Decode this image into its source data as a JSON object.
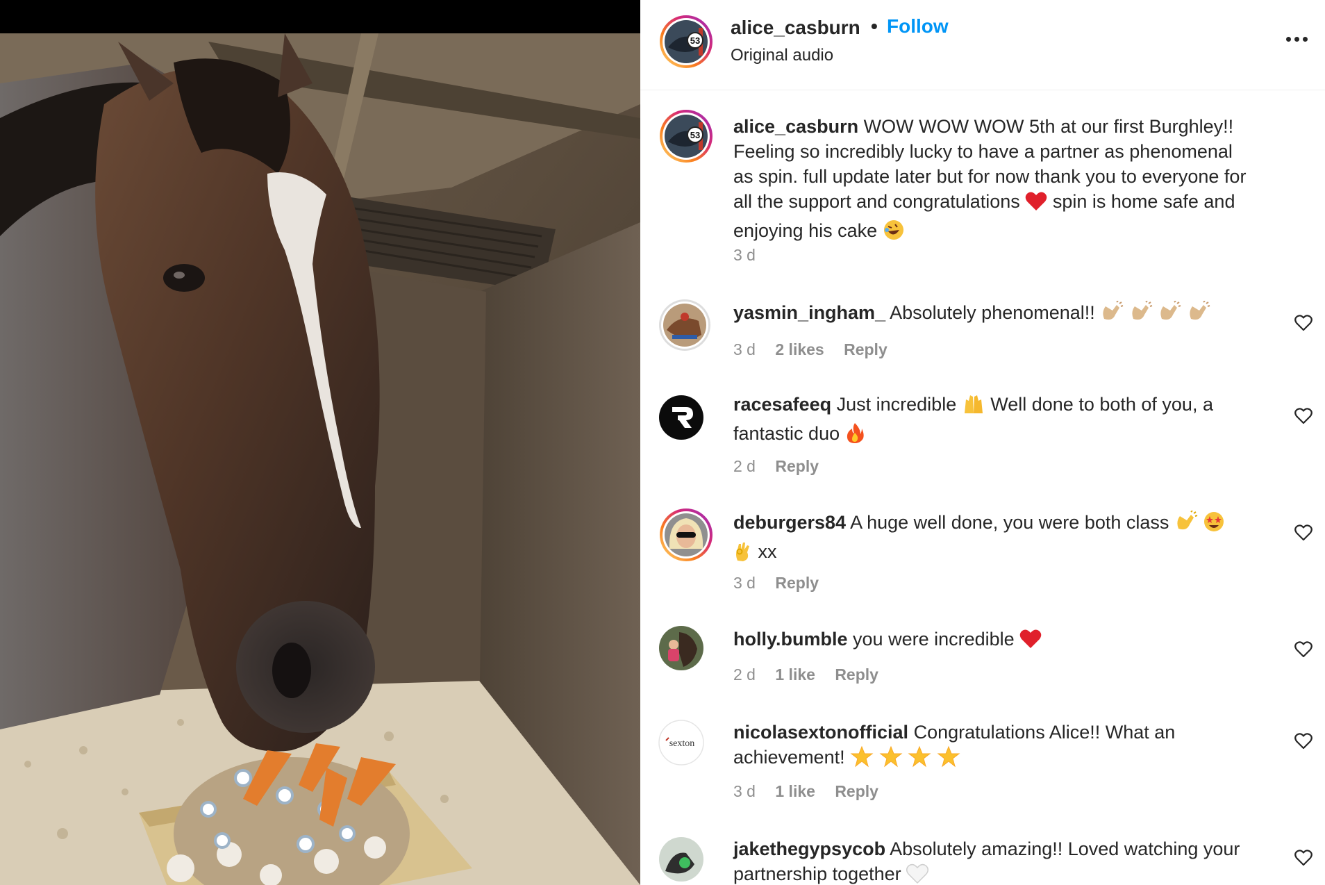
{
  "post": {
    "username": "alice_casburn",
    "separator": "•",
    "follow_label": "Follow",
    "audio_label": "Original audio",
    "avatar_badge": "53",
    "caption": {
      "username": "alice_casburn",
      "line1": "WOW WOW WOW 5th at our first Burghley!!",
      "line2": "Feeling so incredibly lucky to have a partner as phenomenal",
      "line3": "as spin. full update later but for now thank you to everyone for",
      "line4a": "all the support and congratulations",
      "line4b": "spin is home safe and",
      "line5": "enjoying his cake",
      "time": "3 d"
    }
  },
  "comments": [
    {
      "username": "yasmin_ingham_",
      "line1": "Absolutely phenomenal!!",
      "time": "3 d",
      "likes": "2 likes",
      "reply": "Reply",
      "emojis": [
        "clapping-hands",
        "clapping-hands",
        "clapping-hands",
        "clapping-hands"
      ]
    },
    {
      "username": "racesafeeq",
      "line1a": "Just incredible",
      "line1b": "Well done to both of you, a",
      "line2": "fantastic duo",
      "time": "2 d",
      "reply": "Reply",
      "avatar_letter": "R"
    },
    {
      "username": "deburgers84",
      "line1": "A huge well done, you were both class",
      "line2": "xx",
      "time": "3 d",
      "reply": "Reply"
    },
    {
      "username": "holly.bumble",
      "line1": "you were incredible",
      "time": "2 d",
      "likes": "1 like",
      "reply": "Reply"
    },
    {
      "username": "nicolasextonofficial",
      "line1": "Congratulations Alice!! What an",
      "line2": "achievement!",
      "time": "3 d",
      "likes": "1 like",
      "reply": "Reply",
      "avatar_text": "sexton"
    },
    {
      "username": "jakethegypsycob",
      "line1": "Absolutely amazing!! Loved watching your",
      "line2": "partnership together"
    }
  ],
  "colors": {
    "accent": "#0095f6",
    "text": "#262626",
    "secondary": "#8e8e8e",
    "divider": "#efefef"
  },
  "icons": [
    "more-options-icon",
    "heart-icon",
    "red-heart-emoji",
    "rolling-laughing-emoji",
    "clapping-hands-emoji",
    "raising-hands-emoji",
    "fire-emoji",
    "star-struck-emoji",
    "ok-hand-emoji",
    "star-emoji",
    "white-heart-emoji"
  ]
}
